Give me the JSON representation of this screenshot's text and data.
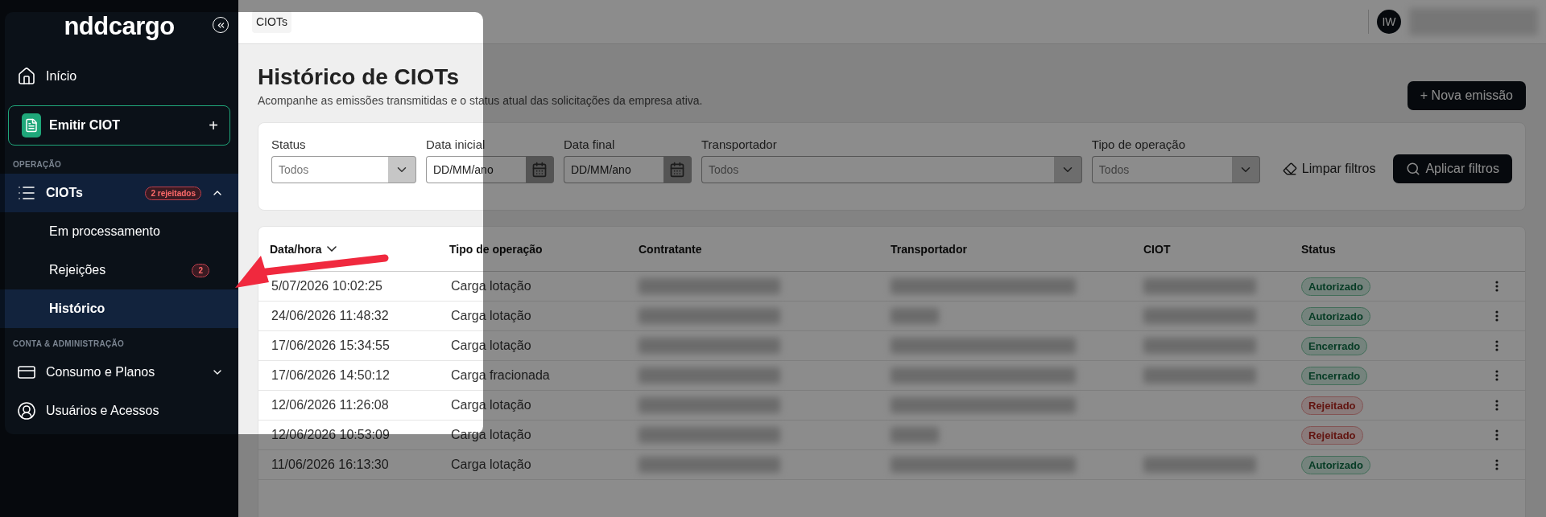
{
  "sidebar": {
    "logo": "nddcargo",
    "top_items": [
      {
        "label": "Início",
        "selected": false
      }
    ],
    "primary_action": {
      "label": "Emitir CIOT",
      "symbol": "+"
    },
    "sections": [
      {
        "title": "OPERAÇÃO",
        "items": [
          {
            "label": "CIOTs",
            "selected": false,
            "expandable": true,
            "expanded": true,
            "badge": "2 rejeitados",
            "children": [
              {
                "label": "Em processamento",
                "selected": false
              },
              {
                "label": "Rejeições",
                "selected": false,
                "badge": "2"
              },
              {
                "label": "Histórico",
                "selected": true
              }
            ]
          }
        ]
      },
      {
        "title": "CONTA & ADMINISTRAÇÃO",
        "items": [
          {
            "label": "Consumo e Planos",
            "selected": false,
            "expandable": true,
            "expanded": false
          },
          {
            "label": "Usuários e Acessos",
            "selected": false
          }
        ]
      }
    ]
  },
  "top_bar": {
    "breadcrumb": "CIOTs",
    "avatar": "IW",
    "user_info_blurred": true
  },
  "page": {
    "title": "Histórico de CIOTs",
    "subtitle": "Acompanhe as emissões transmitidas e o status atual das solicitações da empresa ativa.",
    "new_button": "+ Nova emissão"
  },
  "filters": {
    "fields": [
      {
        "label": "Status",
        "kind": "select",
        "placeholder": "Todos"
      },
      {
        "label": "Data inicial",
        "kind": "date",
        "placeholder": "DD/MM/ano"
      },
      {
        "label": "Data final",
        "kind": "date",
        "placeholder": "DD/MM/ano"
      },
      {
        "label": "Transportador",
        "kind": "select",
        "placeholder": "Todos"
      },
      {
        "label": "Tipo de operação",
        "kind": "select",
        "placeholder": "Todos"
      }
    ],
    "clear_button": "Limpar filtros",
    "apply_button": "Aplicar filtros"
  },
  "table": {
    "columns": [
      {
        "label": "Data/hora",
        "sorted": true
      },
      {
        "label": "Tipo de operação",
        "sorted": false
      },
      {
        "label": "Contratante",
        "sorted": false
      },
      {
        "label": "Transportador",
        "sorted": false
      },
      {
        "label": "CIOT",
        "sorted": false
      },
      {
        "label": "Status",
        "sorted": false
      }
    ],
    "rows": [
      {
        "date": "5/07/2026 10:02:25",
        "type": "Carga lotação",
        "ciot_redacted": true,
        "status": "Autorizado",
        "kind": "success"
      },
      {
        "date": "24/06/2026 11:48:32",
        "type": "Carga lotação",
        "ciot_redacted": true,
        "status": "Autorizado",
        "kind": "success"
      },
      {
        "date": "17/06/2026 15:34:55",
        "type": "Carga lotação",
        "ciot_redacted": true,
        "status": "Encerrado",
        "kind": "success"
      },
      {
        "date": "17/06/2026 14:50:12",
        "type": "Carga fracionada",
        "ciot_redacted": true,
        "status": "Encerrado",
        "kind": "success"
      },
      {
        "date": "12/06/2026 11:26:08",
        "type": "Carga lotação",
        "ciot_redacted": false,
        "status": "Rejeitado",
        "kind": "danger"
      },
      {
        "date": "12/06/2026 10:53:09",
        "type": "Carga lotação",
        "ciot_redacted": false,
        "status": "Rejeitado",
        "kind": "danger"
      },
      {
        "date": "11/06/2026 16:13:30",
        "type": "Carga lotação",
        "ciot_redacted": true,
        "status": "Autorizado",
        "kind": "success"
      }
    ]
  }
}
